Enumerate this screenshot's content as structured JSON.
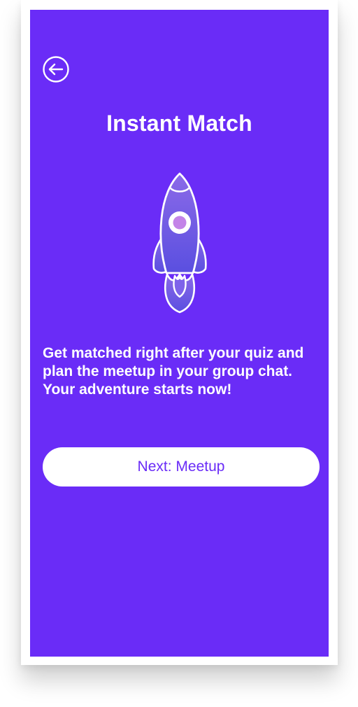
{
  "screen": {
    "title": "Instant Match",
    "description": "Get matched right after your quiz and plan the meetup in your group chat. Your adventure starts now!",
    "next_button_label": "Next: Meetup",
    "icons": {
      "back": "arrow-left-circle-icon",
      "illustration": "rocket-icon"
    }
  },
  "colors": {
    "background": "#6a2cf7",
    "button_background": "#ffffff",
    "button_text": "#6a2cf7",
    "text": "#ffffff"
  }
}
